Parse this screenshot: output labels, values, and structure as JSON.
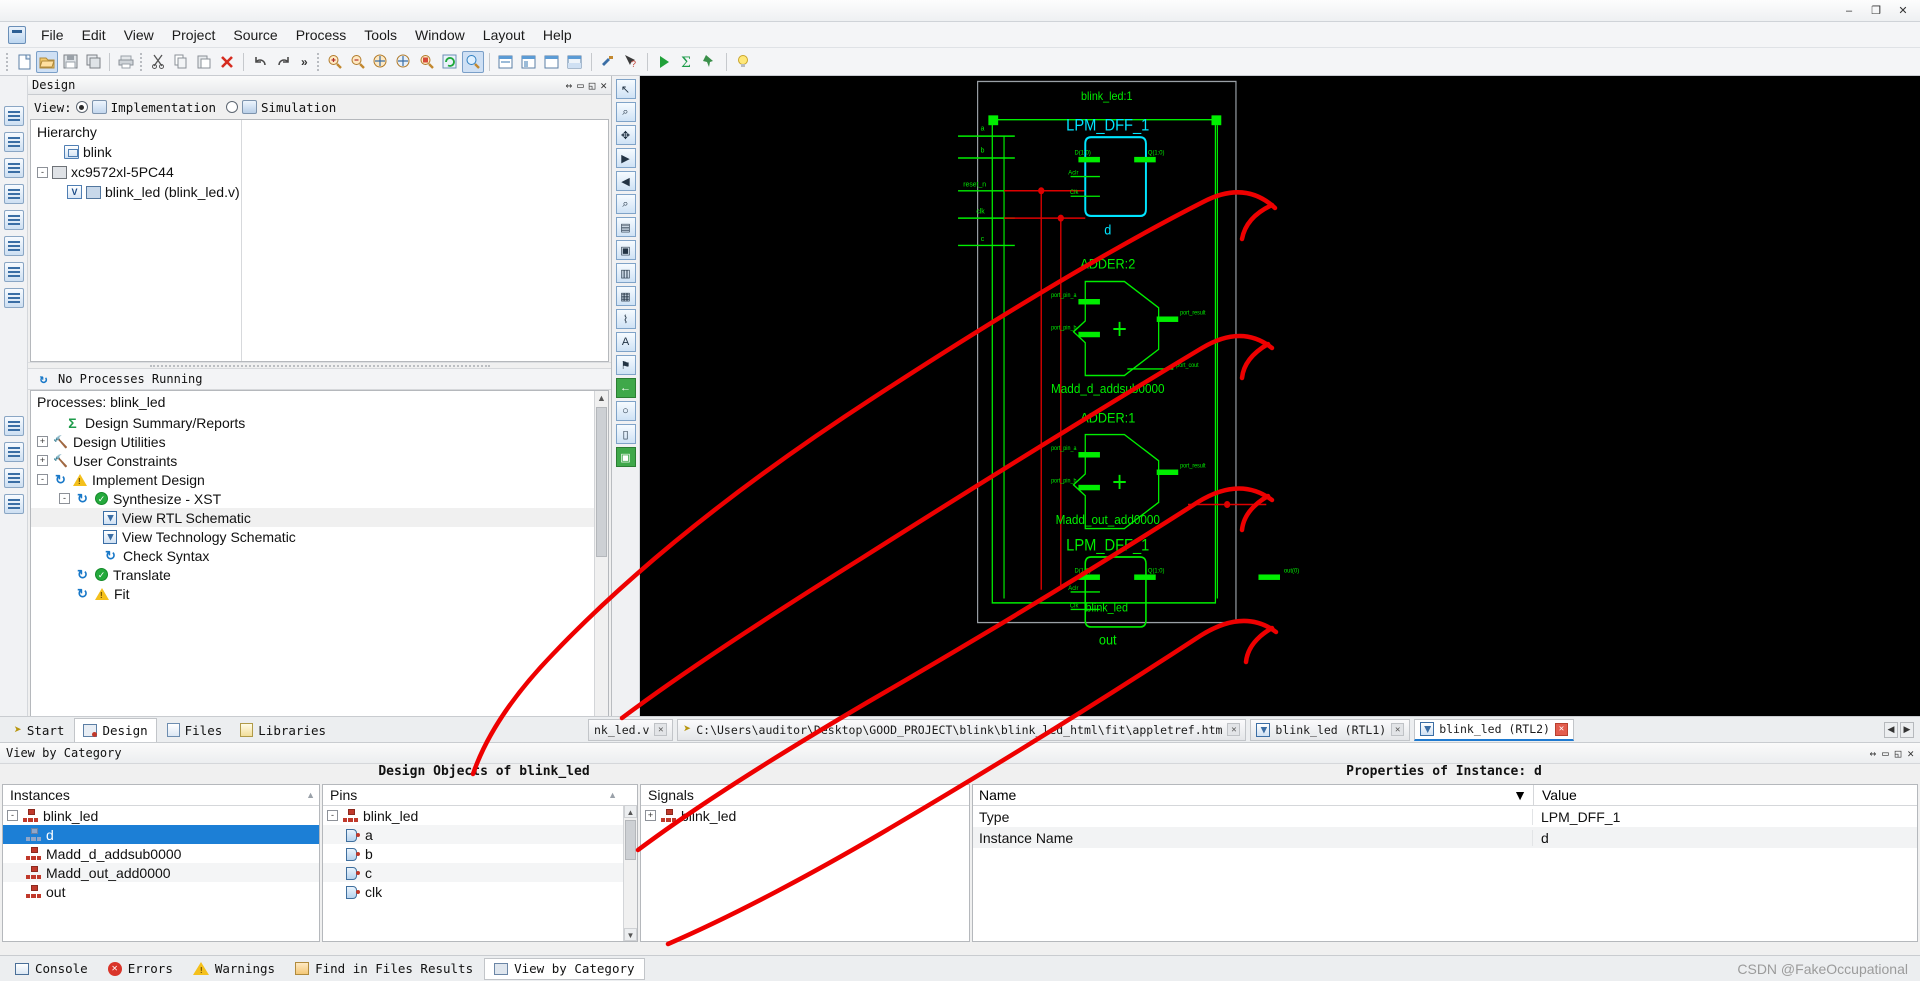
{
  "window": {
    "minimize": "–",
    "maximize": "❐",
    "close": "✕"
  },
  "menu": {
    "items": [
      "File",
      "Edit",
      "View",
      "Project",
      "Source",
      "Process",
      "Tools",
      "Window",
      "Layout",
      "Help"
    ]
  },
  "toolbar": {
    "more": "»",
    "buttons": [
      "new-file-icon",
      "open-project-icon",
      "save-icon",
      "save-all-icon",
      "print-icon",
      "cut-icon",
      "copy-icon",
      "paste-icon",
      "delete-icon",
      "undo-icon",
      "redo-icon",
      "zoom-in-icon",
      "zoom-out-icon",
      "zoom-fit-icon",
      "zoom-selection-icon",
      "zoom-region-icon",
      "refresh-icon",
      "pan-icon",
      "tile-horizontal-icon",
      "tile-vertical-icon",
      "window-1-icon",
      "window-2-icon",
      "settings-icon",
      "help-pointer-icon",
      "run-icon",
      "sigma-icon",
      "pushpin-icon",
      "lightbulb-icon"
    ]
  },
  "design_panel": {
    "title": "Design",
    "controls": [
      "↔",
      "▭",
      "◱",
      "✕"
    ],
    "view_label": "View:",
    "view_options": [
      {
        "label": "Implementation",
        "selected": true
      },
      {
        "label": "Simulation",
        "selected": false
      }
    ],
    "hierarchy_header": "Hierarchy",
    "hierarchy": [
      {
        "label": "blink",
        "indent": 0,
        "icon": "project-icon",
        "expander": ""
      },
      {
        "label": "xc9572xl-5PC44",
        "indent": 0,
        "icon": "device-icon",
        "expander": "-"
      },
      {
        "label": "blink_led (blink_led.v)",
        "indent": 1,
        "icon": "verilog-module-icon",
        "expander": ""
      }
    ],
    "process_status": "No Processes Running",
    "processes_header": "Processes: blink_led",
    "processes": [
      {
        "label": "Design Summary/Reports",
        "indent": 1,
        "expander": "",
        "icon": "sigma-icon",
        "status": "",
        "selected": false
      },
      {
        "label": "Design Utilities",
        "indent": 1,
        "expander": "+",
        "icon": "hammer-icon",
        "status": "",
        "selected": false
      },
      {
        "label": "User Constraints",
        "indent": 1,
        "expander": "+",
        "icon": "hammer-icon",
        "status": "",
        "selected": false
      },
      {
        "label": "Implement Design",
        "indent": 1,
        "expander": "-",
        "icon": "process-icon",
        "status": "warn",
        "selected": false
      },
      {
        "label": "Synthesize - XST",
        "indent": 2,
        "expander": "-",
        "icon": "process-icon",
        "status": "ok",
        "selected": false
      },
      {
        "label": "View RTL Schematic",
        "indent": 4,
        "expander": "",
        "icon": "schematic-icon",
        "status": "",
        "selected": true
      },
      {
        "label": "View Technology Schematic",
        "indent": 4,
        "expander": "",
        "icon": "schematic-icon",
        "status": "",
        "selected": false
      },
      {
        "label": "Check Syntax",
        "indent": 4,
        "expander": "",
        "icon": "process-icon",
        "status": "",
        "selected": false
      },
      {
        "label": "Translate",
        "indent": 2,
        "expander": "",
        "icon": "process-icon",
        "status": "ok",
        "selected": false
      },
      {
        "label": "Fit",
        "indent": 2,
        "expander": "",
        "icon": "process-icon",
        "status": "warn",
        "selected": false
      }
    ]
  },
  "schematic": {
    "sheet_title": "blink_led:1",
    "sheet_footer": "blink_led",
    "input_ports": [
      "a",
      "b",
      "reset_n",
      "clk",
      "c"
    ],
    "output_port": "out(0)",
    "blocks": [
      {
        "type": "LPM_DFF_1",
        "instance": "d",
        "shape": "dff",
        "inputs": [
          "D(1:0)",
          "Aclr",
          "Clk"
        ],
        "outputs": [
          "Q(1:0)"
        ],
        "highlight": "#00e5ff"
      },
      {
        "type": "ADDER:2",
        "instance": "Madd_d_addsub0000",
        "shape": "adder",
        "inputs": [
          "port_pin_a",
          "port_pin_b"
        ],
        "outputs": [
          "port_result",
          "port_cout"
        ],
        "highlight": "#00ee00"
      },
      {
        "type": "ADDER:1",
        "instance": "Madd_out_add0000",
        "shape": "adder",
        "inputs": [
          "port_pin_a",
          "port_pin_b"
        ],
        "outputs": [
          "port_result"
        ],
        "highlight": "#00ee00"
      },
      {
        "type": "LPM_DFF_1",
        "instance": "out",
        "shape": "dff",
        "inputs": [
          "D(1:0)",
          "Aclr",
          "Clk"
        ],
        "outputs": [
          "Q(1:0)"
        ],
        "highlight": "#00ee00"
      }
    ]
  },
  "schematic_tools": {
    "buttons": [
      "select-arrow-icon",
      "zoom-tool-icon",
      "pan-tool-icon",
      "forward-icon",
      "back-icon",
      "find-icon",
      "add-sheet-icon",
      "delete-sheet-icon",
      "print-region-icon",
      "properties-icon",
      "net-icon",
      "text-icon",
      "flag-icon",
      "green-back-icon",
      "gray-icon",
      "pin-icon",
      "green-active-icon"
    ]
  },
  "file_tabs": [
    {
      "label": "nk_led.v",
      "icon": "verilog-file-icon",
      "active": false,
      "close": "✕"
    },
    {
      "label": "C:\\Users\\auditor\\Desktop\\GOOD_PROJECT\\blink\\blink_led_html\\fit\\appletref.htm",
      "icon": "html-file-icon",
      "active": false,
      "close": "✕"
    },
    {
      "label": "blink_led (RTL1)",
      "icon": "schematic-file-icon",
      "active": false,
      "close": "✕"
    },
    {
      "label": "blink_led (RTL2)",
      "icon": "schematic-file-icon",
      "active": true,
      "close": "✕"
    }
  ],
  "tab_nav": [
    "◀",
    "▶"
  ],
  "left_bottom_tabs": [
    {
      "label": "Start",
      "icon": "start-icon",
      "active": false
    },
    {
      "label": "Design",
      "icon": "design-icon",
      "active": true
    },
    {
      "label": "Files",
      "icon": "files-icon",
      "active": false
    },
    {
      "label": "Libraries",
      "icon": "libraries-icon",
      "active": false
    }
  ],
  "view_by_category": {
    "label": "View by Category",
    "controls": [
      "↔",
      "▭",
      "◱",
      "✕"
    ]
  },
  "object_headers": {
    "design_objects": "Design Objects of blink_led",
    "properties": "Properties of Instance: d"
  },
  "instances_pane": {
    "header": "Instances",
    "sort": "▲",
    "rows": [
      {
        "label": "blink_led",
        "indent": 0,
        "expander": "-",
        "selected": false
      },
      {
        "label": "d",
        "indent": 1,
        "expander": "",
        "selected": true
      },
      {
        "label": "Madd_d_addsub0000",
        "indent": 1,
        "expander": "",
        "selected": false
      },
      {
        "label": "Madd_out_add0000",
        "indent": 1,
        "expander": "",
        "selected": false
      },
      {
        "label": "out",
        "indent": 1,
        "expander": "",
        "selected": false
      }
    ]
  },
  "pins_pane": {
    "header": "Pins",
    "sort": "▲",
    "rows": [
      {
        "label": "blink_led",
        "indent": 0,
        "expander": "-",
        "type": "inst"
      },
      {
        "label": "a",
        "indent": 1,
        "expander": "",
        "type": "pin"
      },
      {
        "label": "b",
        "indent": 1,
        "expander": "",
        "type": "pin"
      },
      {
        "label": "c",
        "indent": 1,
        "expander": "",
        "type": "pin"
      },
      {
        "label": "clk",
        "indent": 1,
        "expander": "",
        "type": "pin"
      }
    ]
  },
  "signals_pane": {
    "header": "Signals",
    "rows": [
      {
        "label": "blink_led",
        "indent": 0,
        "expander": "+",
        "type": "inst"
      }
    ]
  },
  "properties_pane": {
    "col_name": "Name",
    "col_value": "Value",
    "sort": "▼",
    "rows": [
      {
        "name": "Type",
        "value": "LPM_DFF_1"
      },
      {
        "name": "Instance Name",
        "value": "d"
      }
    ]
  },
  "status_tabs": [
    {
      "label": "Console",
      "icon": "console-icon",
      "active": false
    },
    {
      "label": "Errors",
      "icon": "error-icon",
      "active": false
    },
    {
      "label": "Warnings",
      "icon": "warning-icon",
      "active": false
    },
    {
      "label": "Find in Files Results",
      "icon": "find-icon",
      "active": false
    },
    {
      "label": "View by Category",
      "icon": "category-icon",
      "active": true
    }
  ],
  "watermark": "CSDN @FakeOccupational",
  "colors": {
    "schematic_bg": "#000000",
    "schematic_green": "#00ee00",
    "schematic_cyan": "#00e5ff",
    "annotation_red": "#ee0000",
    "selection_blue": "#1c7fd6"
  }
}
